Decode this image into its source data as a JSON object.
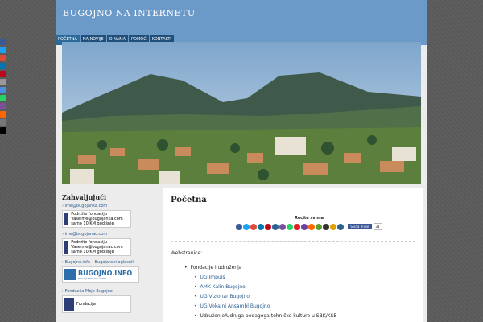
{
  "site": {
    "title": "BUGOJNO NA INTERNETU"
  },
  "nav": [
    {
      "label": "POČETNA",
      "active": true
    },
    {
      "label": "NAJNOVIJE",
      "active": false
    },
    {
      "label": "O NAMA",
      "active": false
    },
    {
      "label": "POMOĆ",
      "active": false
    },
    {
      "label": "KONTAKTI",
      "active": false
    }
  ],
  "share_rail_colors": [
    "#3b5998",
    "#1da1f2",
    "#dd4b39",
    "#0077b5",
    "#bd081c",
    "#999999",
    "#4a90e2",
    "#25d366",
    "#7b519d",
    "#ff6600",
    "#777777",
    "#000000"
  ],
  "sidebar": {
    "heading": "Zahvaljujući",
    "entries": [
      {
        "link": "› ime@bugojanka.com",
        "card": "Podržite fondaciju Vaselme@bugojanka.com samo 10 KM godišnje"
      },
      {
        "link": "› ime@bugojanac.com",
        "card": "Podržite fondaciju Vaselme@bugojanac.com samo 10 KM godišnje"
      }
    ],
    "oglasnik_link": "› Bugojno.info – Bugojanski oglasnik",
    "logo_text": "BUGOJNO.INFO",
    "logo_sub": "BUGOJANSKI OGLASNIK",
    "fondacija_link": "› Fondacija Moje Bugojno",
    "fondacija_card": "Fondacija"
  },
  "content": {
    "title": "Početna",
    "share_label": "Recite svima",
    "share_icons": [
      "#3b5998",
      "#1da1f2",
      "#dd4b39",
      "#0077b5",
      "#bd081c",
      "#2d5f8f",
      "#7b519d",
      "#25d366",
      "#e02020",
      "#6b3fa0",
      "#ff6600",
      "#5a9e2f",
      "#333333",
      "#e0a000",
      "#2d5f8f"
    ],
    "fb_like": "Sviđa mi se",
    "fb_count": "31",
    "section_label": "Webstranice:",
    "group_label": "Fondacije i udruženja",
    "links": [
      "UG Impuls",
      "AMK Kalin Bugojno",
      "UG Vizionar Bugojno",
      "UG Vokalni Ansambl Bugojno",
      "Udruženje/Udruga pedagoga tehničke kulture u SBK/KSB"
    ]
  }
}
